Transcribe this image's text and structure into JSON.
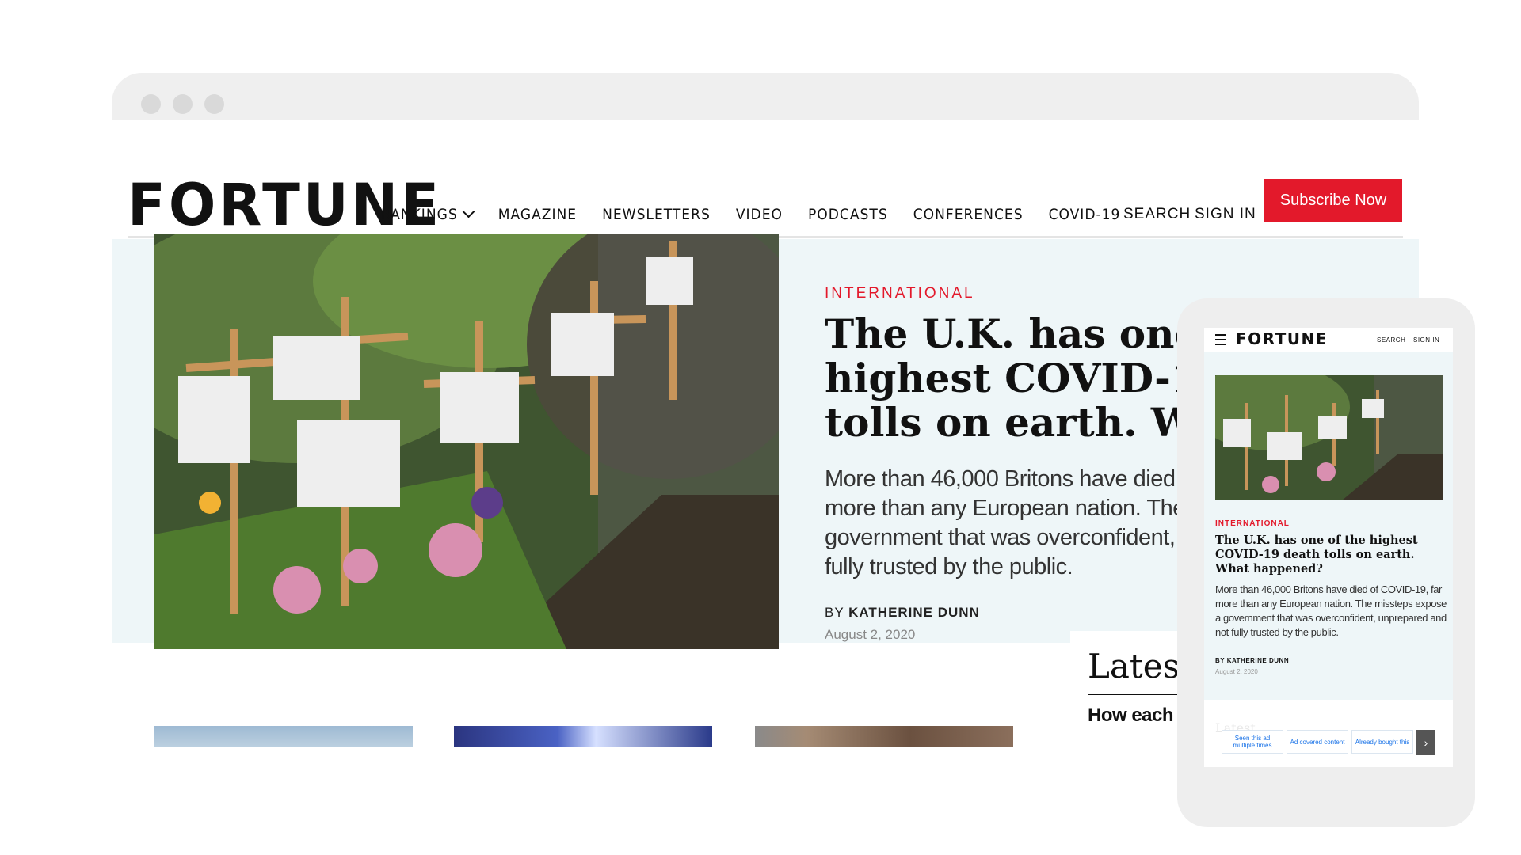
{
  "desktop": {
    "logo": "FORTUNE",
    "nav": [
      "RANKINGS",
      "MAGAZINE",
      "NEWSLETTERS",
      "VIDEO",
      "PODCASTS",
      "CONFERENCES",
      "COVID-19"
    ],
    "search_label": "SEARCH",
    "signin_label": "SIGN IN",
    "subscribe_label": "Subscribe Now",
    "hero": {
      "kicker": "INTERNATIONAL",
      "headline": "The U.K. has one of the highest COVID-19 death tolls on earth. What happened?",
      "dek": "More than 46,000 Britons have died of COVID-19, far more than any European nation. The missteps expose a government that was overconfident, unprepared and not fully trusted by the public.",
      "byline_prefix": "BY",
      "author": "KATHERINE DUNN",
      "date": "August 2, 2020"
    },
    "latest": {
      "title": "Latest",
      "first_item": "How each NFL team is handling"
    }
  },
  "mobile": {
    "logo": "FORTUNE",
    "search_label": "SEARCH",
    "signin_label": "SIGN IN",
    "kicker": "INTERNATIONAL",
    "headline": "The U.K. has one of the highest COVID-19 death tolls on earth. What happened?",
    "dek": "More than 46,000 Britons have died of COVID-19, far more than any European nation. The missteps expose a government that was overconfident, unprepared and not fully trusted by the public.",
    "byline": "BY KATHERINE DUNN",
    "date": "August 2, 2020",
    "latest": "Latest",
    "ad_feedback": [
      "Seen this ad multiple times",
      "Ad covered content",
      "Already bought this"
    ]
  },
  "colors": {
    "accent": "#e3192b",
    "hero_bg": "#eef6f8",
    "chrome": "#efefef"
  },
  "icons": {
    "nav_dropdown": "chevron-down-icon",
    "mobile_menu": "hamburger-icon",
    "ad_next": "chevron-right-icon"
  }
}
